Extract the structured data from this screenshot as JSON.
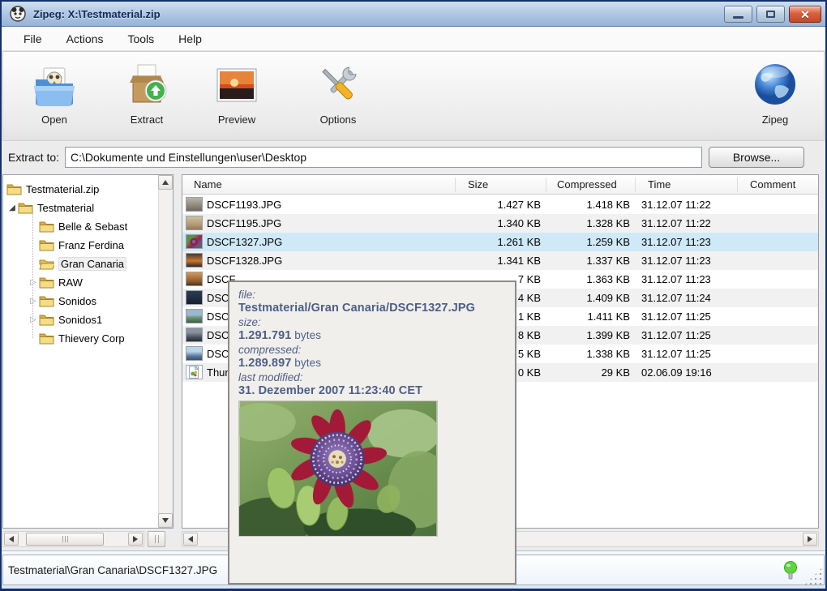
{
  "window": {
    "title": "Zipeg: X:\\Testmaterial.zip",
    "buttons": {
      "minimize": "minimize",
      "maximize": "maximize",
      "close": "close"
    }
  },
  "menu": {
    "items": [
      "File",
      "Actions",
      "Tools",
      "Help"
    ]
  },
  "toolbar": {
    "buttons": [
      {
        "label": "Open",
        "icon": "open-archive-icon"
      },
      {
        "label": "Extract",
        "icon": "extract-icon"
      },
      {
        "label": "Preview",
        "icon": "preview-icon"
      },
      {
        "label": "Options",
        "icon": "options-icon"
      }
    ],
    "brand": {
      "label": "Zipeg",
      "icon": "zipeg-globe-icon"
    }
  },
  "extract": {
    "label": "Extract to:",
    "path": "C:\\Dokumente und Einstellungen\\user\\Desktop",
    "browse_label": "Browse..."
  },
  "tree": {
    "items": [
      {
        "label": "Testmaterial.zip",
        "level": 0,
        "icon": "folder-closed",
        "expander": "none"
      },
      {
        "label": "Testmaterial",
        "level": 1,
        "icon": "folder-closed",
        "expander": "expanded"
      },
      {
        "label": "Belle & Sebast",
        "level": 2,
        "icon": "folder-closed",
        "expander": "none"
      },
      {
        "label": "Franz Ferdina",
        "level": 2,
        "icon": "folder-closed",
        "expander": "none"
      },
      {
        "label": "Gran Canaria",
        "level": 2,
        "icon": "folder-open",
        "expander": "none",
        "selected": true
      },
      {
        "label": "RAW",
        "level": 2,
        "icon": "folder-closed",
        "expander": "collapsed"
      },
      {
        "label": "Sonidos",
        "level": 2,
        "icon": "folder-closed",
        "expander": "collapsed"
      },
      {
        "label": "Sonidos1",
        "level": 2,
        "icon": "folder-closed",
        "expander": "collapsed"
      },
      {
        "label": "Thievery Corp",
        "level": 2,
        "icon": "folder-closed",
        "expander": "none"
      }
    ]
  },
  "list": {
    "columns": [
      "Name",
      "Size",
      "Compressed",
      "Time",
      "Comment"
    ],
    "rows": [
      {
        "name": "DSCF1193.JPG",
        "size": "1.427 KB",
        "compressed": "1.418 KB",
        "time": "31.12.07 11:22",
        "comment": "",
        "thumb": "t1"
      },
      {
        "name": "DSCF1195.JPG",
        "size": "1.340 KB",
        "compressed": "1.328 KB",
        "time": "31.12.07 11:22",
        "comment": "",
        "thumb": "t2"
      },
      {
        "name": "DSCF1327.JPG",
        "size": "1.261 KB",
        "compressed": "1.259 KB",
        "time": "31.12.07 11:23",
        "comment": "",
        "thumb": "t3",
        "selected": true
      },
      {
        "name": "DSCF1328.JPG",
        "size": "1.341 KB",
        "compressed": "1.337 KB",
        "time": "31.12.07 11:23",
        "comment": "",
        "thumb": "t4"
      },
      {
        "name": "DSCF",
        "size": "7 KB",
        "compressed": "1.363 KB",
        "time": "31.12.07 11:23",
        "comment": "",
        "thumb": "t5"
      },
      {
        "name": "DSCF",
        "size": "4 KB",
        "compressed": "1.409 KB",
        "time": "31.12.07 11:24",
        "comment": "",
        "thumb": "t6"
      },
      {
        "name": "DSCF",
        "size": "1 KB",
        "compressed": "1.411 KB",
        "time": "31.12.07 11:25",
        "comment": "",
        "thumb": "t7"
      },
      {
        "name": "DSCF",
        "size": "8 KB",
        "compressed": "1.399 KB",
        "time": "31.12.07 11:25",
        "comment": "",
        "thumb": "t8"
      },
      {
        "name": "DSCF",
        "size": "5 KB",
        "compressed": "1.338 KB",
        "time": "31.12.07 11:25",
        "comment": "",
        "thumb": "t9"
      },
      {
        "name": "Thum",
        "size": "0 KB",
        "compressed": "29 KB",
        "time": "02.06.09 19:16",
        "comment": "",
        "thumb": "page"
      }
    ]
  },
  "tooltip": {
    "file_label": "file:",
    "file": "Testmaterial/Gran Canaria/DSCF1327.JPG",
    "size_label": "size:",
    "size_value": "1.291.791",
    "size_unit": " bytes",
    "compressed_label": "compressed:",
    "compressed_value": "1.289.897",
    "compressed_unit": " bytes",
    "modified_label": "last modified:",
    "modified": "31. Dezember 2007 11:23:40 CET",
    "photo": "passion-flower-photo"
  },
  "status": {
    "path": "Testmaterial\\Gran Canaria\\DSCF1327.JPG"
  },
  "colors": {
    "selected_row": "#cfe9f7",
    "stripe_row": "#f1f1f1",
    "titlebar_top": "#cfdff0",
    "titlebar_bottom": "#96b3d8",
    "tooltip_bg": "#f1efec",
    "tooltip_text": "#4d5e85",
    "close_button": "#c24a28",
    "folder_yellow": "#f2d270"
  }
}
